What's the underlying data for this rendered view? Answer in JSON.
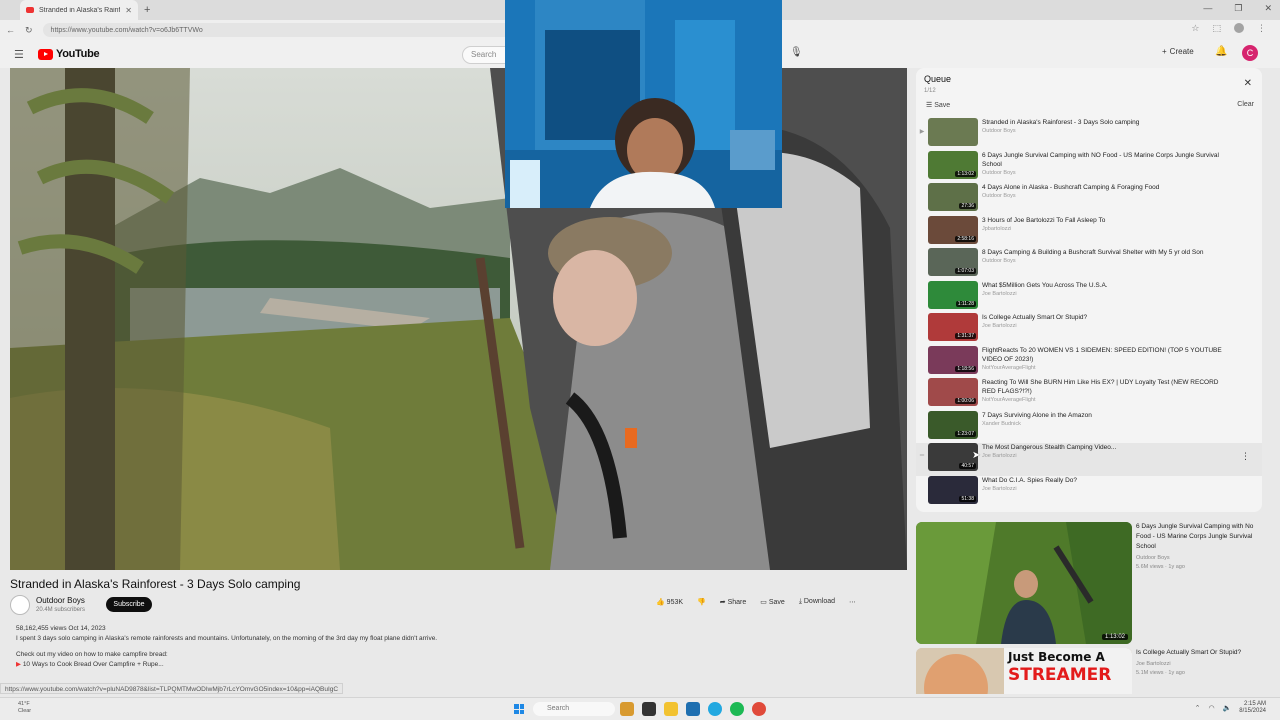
{
  "browser": {
    "tab_title": "Stranded in Alaska's Rainforest",
    "url": "https://www.youtube.com/watch?v=o6Jb6TTVWo",
    "window_controls": [
      "—",
      "❐",
      "✕"
    ]
  },
  "youtube": {
    "logo_text": "YouTube",
    "search_placeholder": "Search",
    "create_label": "Create",
    "avatar_letter": "C"
  },
  "video": {
    "title": "Stranded in Alaska's Rainforest - 3 Days Solo camping",
    "channel": "Outdoor Boys",
    "subscribers": "20.4M subscribers",
    "subscribe_label": "Subscribe",
    "likes": "953K",
    "share_label": "Share",
    "save_label": "Save",
    "download_label": "Download",
    "views_date": "58,162,455 views  Oct 14, 2023",
    "description_line1": "I spent 3 days solo camping in Alaska's remote rainforests and mountains. Unfortunately, on the morning of the 3rd day my float plane didn't arrive.",
    "description_line2": "Check out my video on how to make campfire bread:",
    "description_line3": "10 Ways to Cook Bread Over Campfire + Rupe...",
    "status_url": "https://www.youtube.com/watch?v=pluNAD9878&list=TLPQMTMwODIwMjb7rLcYOmvGO5index=10&pp=iAQBuIgC"
  },
  "queue": {
    "title": "Queue",
    "count": "1/12",
    "save_label": "Save",
    "clear_label": "Clear",
    "items": [
      {
        "title": "Stranded in Alaska's Rainforest - 3 Days Solo camping",
        "channel": "Outdoor Boys",
        "duration": "",
        "color": "#6b7a52",
        "playing": true
      },
      {
        "title": "6 Days Jungle Survival Camping with NO Food - US Marine Corps Jungle Survival School",
        "channel": "Outdoor Boys",
        "duration": "1:13:02",
        "color": "#4f7a34"
      },
      {
        "title": "4 Days Alone in Alaska - Bushcraft Camping & Foraging Food",
        "channel": "Outdoor Boys",
        "duration": "27:36",
        "color": "#5e7048"
      },
      {
        "title": "3 Hours of Joe Bartolozzi To Fall Asleep To",
        "channel": "Jpbartolozzi",
        "duration": "2:58:16",
        "color": "#6b4a3a"
      },
      {
        "title": "8 Days Camping & Building a Bushcraft Survival Shelter with My 5 yr old Son",
        "channel": "Outdoor Boys",
        "duration": "1:07:03",
        "color": "#5a6658"
      },
      {
        "title": "What $5Million Gets You Across The U.S.A.",
        "channel": "Joe Bartolozzi",
        "duration": "1:11:28",
        "color": "#2e8a3a"
      },
      {
        "title": "Is College Actually Smart Or Stupid?",
        "channel": "Joe Bartolozzi",
        "duration": "1:31:37",
        "color": "#b03a3a"
      },
      {
        "title": "FlightReacts To 20 WOMEN VS 1 SIDEMEN: SPEED EDITION! (TOP 5 YOUTUBE VIDEO OF 2023!)",
        "channel": "NotYourAverageFlight",
        "duration": "1:18:56",
        "color": "#7a3a5a"
      },
      {
        "title": "Reacting To Will She BURN Him Like His EX? | UDY Loyalty Test (NEW RECORD RED FLAGS?!?!)",
        "channel": "NotYourAverageFlight",
        "duration": "1:00:06",
        "color": "#a04a4a"
      },
      {
        "title": "7 Days Surviving Alone in the Amazon",
        "channel": "Xander Budnick",
        "duration": "1:23:07",
        "color": "#3a5a2a"
      },
      {
        "title": "The Most Dangerous Stealth Camping Video...",
        "channel": "Joe Bartolozzi",
        "duration": "40:57",
        "color": "#3a3a3a"
      },
      {
        "title": "What Do C.I.A. Spies Really Do?",
        "channel": "Joe Bartolozzi",
        "duration": "51:38",
        "color": "#2a2a3a"
      }
    ]
  },
  "recommendations": [
    {
      "title": "6 Days Jungle Survival Camping with No Food - US Marine Corps Jungle Survival School",
      "channel": "Outdoor Boys",
      "meta": "5.6M views · 1y ago",
      "duration": "1:13:02"
    },
    {
      "title": "Is College Actually Smart Or Stupid?",
      "channel": "Joe Bartolozzi",
      "meta": "5.1M views · 1y ago",
      "thumb_text_1": "Just Become A",
      "thumb_text_2": "STREAMER"
    }
  ],
  "taskbar": {
    "weather_temp": "41°F",
    "weather_desc": "Clear",
    "search_label": "Search",
    "time": "2:15 AM",
    "date": "8/15/2024"
  }
}
